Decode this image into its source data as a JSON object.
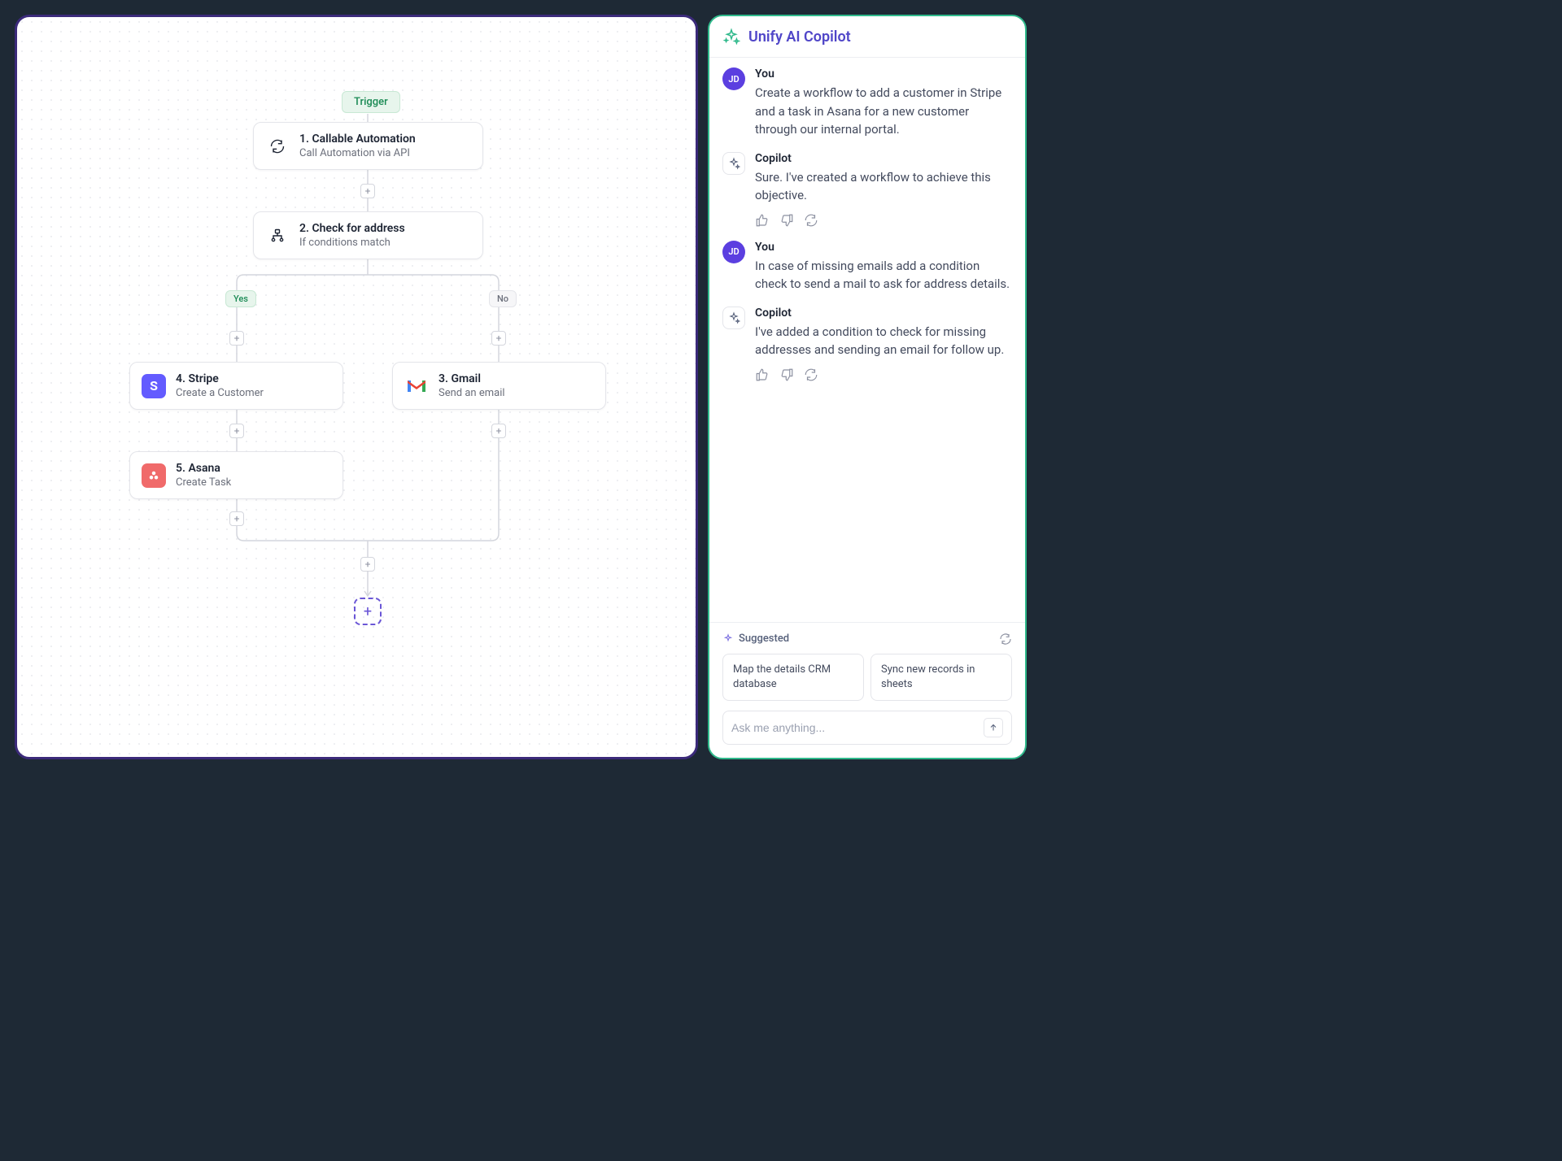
{
  "canvas": {
    "trigger_label": "Trigger",
    "yes_label": "Yes",
    "no_label": "No",
    "nodes": {
      "n1": {
        "title": "1. Callable Automation",
        "subtitle": "Call Automation via API"
      },
      "n2": {
        "title": "2. Check for address",
        "subtitle": "If conditions match"
      },
      "n3": {
        "title": "3. Gmail",
        "subtitle": "Send an email"
      },
      "n4": {
        "title": "4. Stripe",
        "subtitle": "Create a Customer"
      },
      "n5": {
        "title": "5. Asana",
        "subtitle": "Create Task"
      }
    }
  },
  "copilot": {
    "title": "Unify AI Copilot",
    "user_initials": "JD",
    "messages": [
      {
        "author": "You",
        "role": "user",
        "text": "Create a workflow to add a customer in Stripe and a task in Asana for a new customer through our internal portal."
      },
      {
        "author": "Copilot",
        "role": "ai",
        "text": "Sure. I've created a workflow to achieve this objective."
      },
      {
        "author": "You",
        "role": "user",
        "text": "In case of missing emails add a condition check to send a mail to ask for address details."
      },
      {
        "author": "Copilot",
        "role": "ai",
        "text": "I've added a condition to check for missing addresses and sending an email for follow up."
      }
    ],
    "suggested_label": "Suggested",
    "suggested": [
      "Map the details CRM database",
      "Sync new records in sheets"
    ],
    "input_placeholder": "Ask me anything..."
  }
}
